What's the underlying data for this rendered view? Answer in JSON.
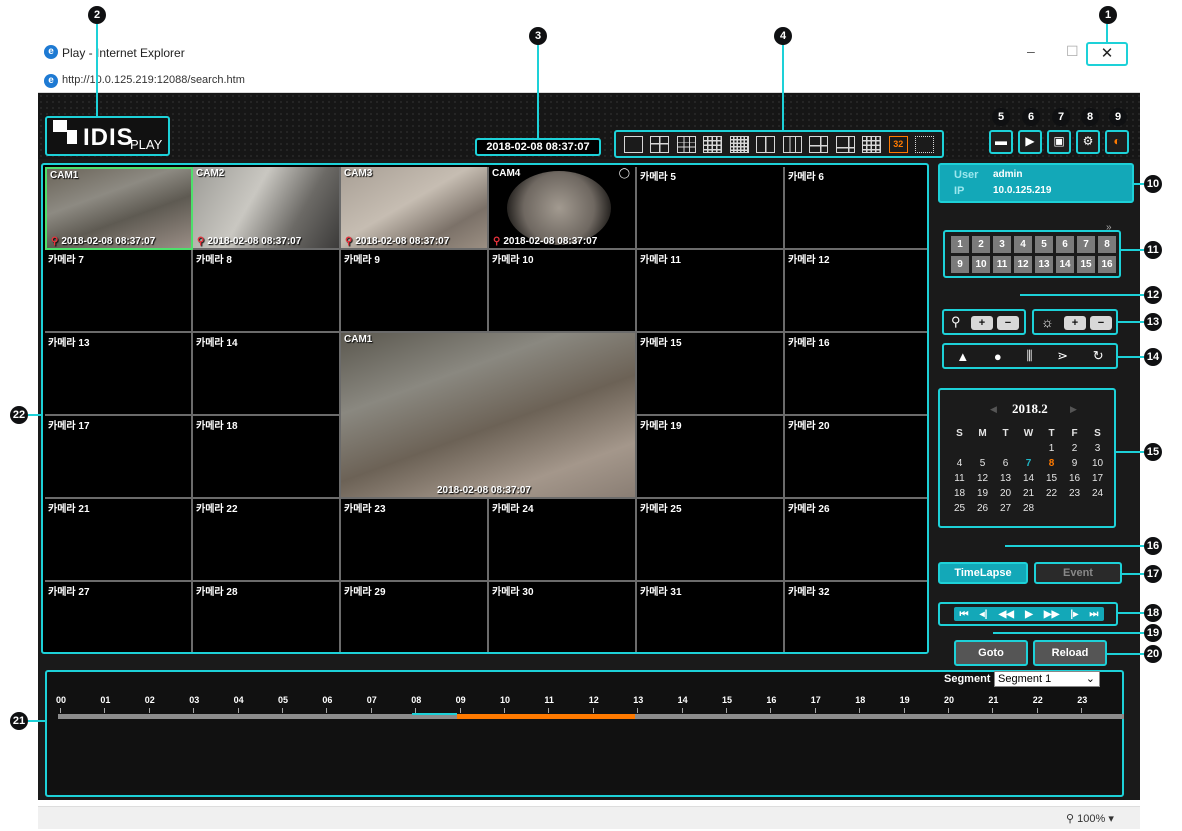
{
  "window": {
    "title": "Play - Internet Explorer",
    "url": "http://10.0.125.219:12088/search.htm",
    "minimize": "–",
    "maximize": "☐",
    "close": "✕"
  },
  "header": {
    "logo_text": "IDIS",
    "logo_sub": "PLAY",
    "datetime": "2018-02-08 08:37:07",
    "layout_active_label": "32"
  },
  "cameras": {
    "cam1": {
      "label": "CAM1",
      "timestamp": "2018-02-08 08:37:07"
    },
    "cam2": {
      "label": "CAM2",
      "timestamp": "2018-02-08 08:37:07"
    },
    "cam3": {
      "label": "CAM3",
      "timestamp": "2018-02-08 08:37:07"
    },
    "cam4": {
      "label": "CAM4",
      "timestamp": "2018-02-08 08:37:07"
    },
    "large": {
      "label": "CAM1",
      "timestamp": "2018-02-08 08:37:07"
    },
    "c5": "카메라 5",
    "c6": "카메라 6",
    "c7": "카메라 7",
    "c8": "카메라 8",
    "c9": "카메라 9",
    "c10": "카메라 10",
    "c11": "카메라 11",
    "c12": "카메라 12",
    "c13": "카메라 13",
    "c14": "카메라 14",
    "c15": "카메라 15",
    "c16": "카메라 16",
    "c17": "카메라 17",
    "c18": "카메라 18",
    "c19": "카메라 19",
    "c20": "카메라 20",
    "c21": "카메라 21",
    "c22": "카메라 22",
    "c23": "카메라 23",
    "c24": "카메라 24",
    "c25": "카메라 25",
    "c26": "카메라 26",
    "c27": "카메라 27",
    "c28": "카메라 28",
    "c29": "카메라 29",
    "c30": "카메라 30",
    "c31": "카메라 31",
    "c32": "카메라 32"
  },
  "user": {
    "user_key": "User",
    "user_val": "admin",
    "ip_key": "IP",
    "ip_val": "10.0.125.219"
  },
  "camera_numbers": [
    "1",
    "2",
    "3",
    "4",
    "5",
    "6",
    "7",
    "8",
    "9",
    "10",
    "11",
    "12",
    "13",
    "14",
    "15",
    "16"
  ],
  "zoom": {
    "plus": "+",
    "minus": "−"
  },
  "brightness": {
    "plus": "+",
    "minus": "−"
  },
  "calendar": {
    "title": "2018.2",
    "prev": "◀",
    "next": "▶",
    "weekdays": [
      "S",
      "M",
      "T",
      "W",
      "T",
      "F",
      "S"
    ],
    "weeks": [
      [
        "",
        "",
        "",
        "",
        "1",
        "2",
        "3"
      ],
      [
        "4",
        "5",
        "6",
        "7",
        "8",
        "9",
        "10"
      ],
      [
        "11",
        "12",
        "13",
        "14",
        "15",
        "16",
        "17"
      ],
      [
        "18",
        "19",
        "20",
        "21",
        "22",
        "23",
        "24"
      ],
      [
        "25",
        "26",
        "27",
        "28",
        "",
        "",
        ""
      ]
    ],
    "highlight_blue": "7",
    "highlight_orange": "8"
  },
  "buttons": {
    "timelapse": "TimeLapse",
    "event": "Event",
    "goto": "Goto",
    "reload": "Reload"
  },
  "timeline": {
    "segment_label": "Segment",
    "segment_value": "Segment 1",
    "hours": [
      "00",
      "01",
      "02",
      "03",
      "04",
      "05",
      "06",
      "07",
      "08",
      "09",
      "10",
      "11",
      "12",
      "13",
      "14",
      "15",
      "16",
      "17",
      "18",
      "19",
      "20",
      "21",
      "22",
      "23"
    ]
  },
  "status": {
    "zoom": "100%"
  },
  "callouts": [
    "1",
    "2",
    "3",
    "4",
    "5",
    "6",
    "7",
    "8",
    "9",
    "10",
    "11",
    "12",
    "13",
    "14",
    "15",
    "16",
    "17",
    "18",
    "19",
    "20",
    "21",
    "22"
  ],
  "colors": {
    "accent": "#1dd1d8",
    "orange": "#ff7a00",
    "teal_bg": "#13a8b8"
  }
}
